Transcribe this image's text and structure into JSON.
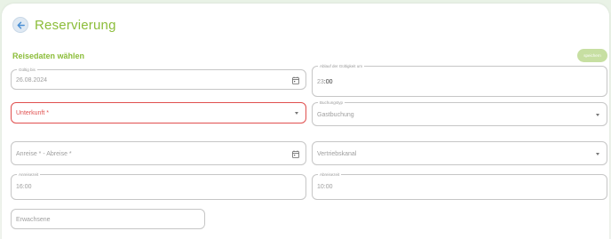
{
  "header": {
    "title": "Reservierung"
  },
  "section": {
    "title": "Reisedaten wählen"
  },
  "toolbar": {
    "save_label": "speichern"
  },
  "form": {
    "valid_until": {
      "label": "Gültig bis",
      "value": "26.08.2024"
    },
    "expiry_time": {
      "label": "Ablauf der Gültigkeit um",
      "hour": "23",
      "minute": ":00"
    },
    "accommodation": {
      "placeholder": "Unterkunft *"
    },
    "booking_type": {
      "label": "Buchungstyp",
      "value": "Gastbuchung"
    },
    "arrival_departure": {
      "placeholder": "Anreise * - Abreise *"
    },
    "sales_channel": {
      "placeholder": "Vertriebskanal"
    },
    "arrival_time": {
      "label": "Anreisezeit",
      "value": "16:00"
    },
    "departure_time": {
      "label": "Abreisezeit",
      "value": "10:00"
    },
    "adults": {
      "placeholder": "Erwachsene"
    }
  },
  "colors": {
    "accent": "#8cbd3a",
    "error": "#e0504f",
    "button_bg": "#c7dfa2"
  },
  "icons": {
    "back": "arrow-left-icon",
    "calendar": "calendar-icon",
    "dropdown": "chevron-down-icon"
  }
}
